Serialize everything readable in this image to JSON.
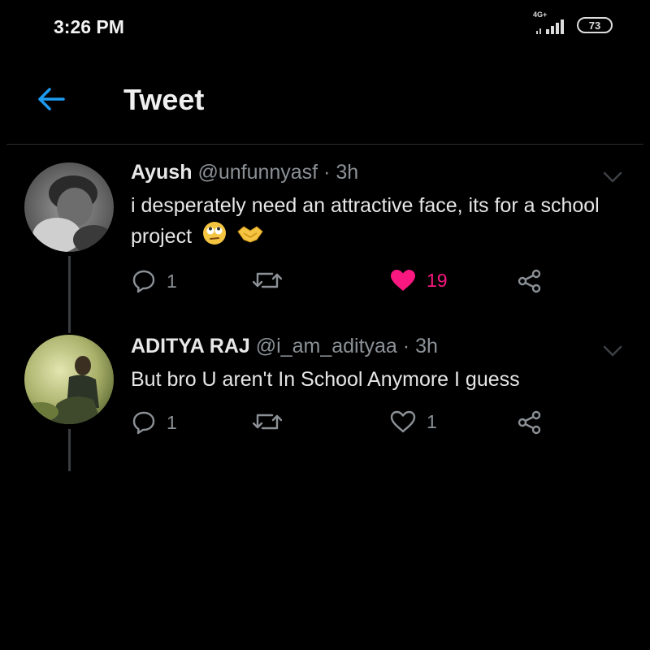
{
  "status_bar": {
    "time": "3:26 PM",
    "network": "4G+",
    "battery": "73"
  },
  "header": {
    "title": "Tweet",
    "back_icon": "arrow-left-icon",
    "accent_color": "#1d9bf0"
  },
  "tweets": [
    {
      "display_name": "Ayush",
      "handle": "@unfunnyasf",
      "separator": "·",
      "time": "3h",
      "text": "i desperately need an attractive face, its for a school project",
      "emojis": [
        "rolling-eyes-emoji",
        "handshake-emoji"
      ],
      "replies": "1",
      "retweets": "",
      "likes": "19",
      "liked": true
    },
    {
      "display_name": "ADITYA RAJ",
      "handle": "@i_am_adityaa",
      "separator": "·",
      "time": "3h",
      "text": "But bro U aren't In School Anymore I guess",
      "replies": "1",
      "retweets": "",
      "likes": "1",
      "liked": false
    }
  ],
  "colors": {
    "background": "#000000",
    "like_active": "#f91880",
    "muted": "#8b9196"
  }
}
